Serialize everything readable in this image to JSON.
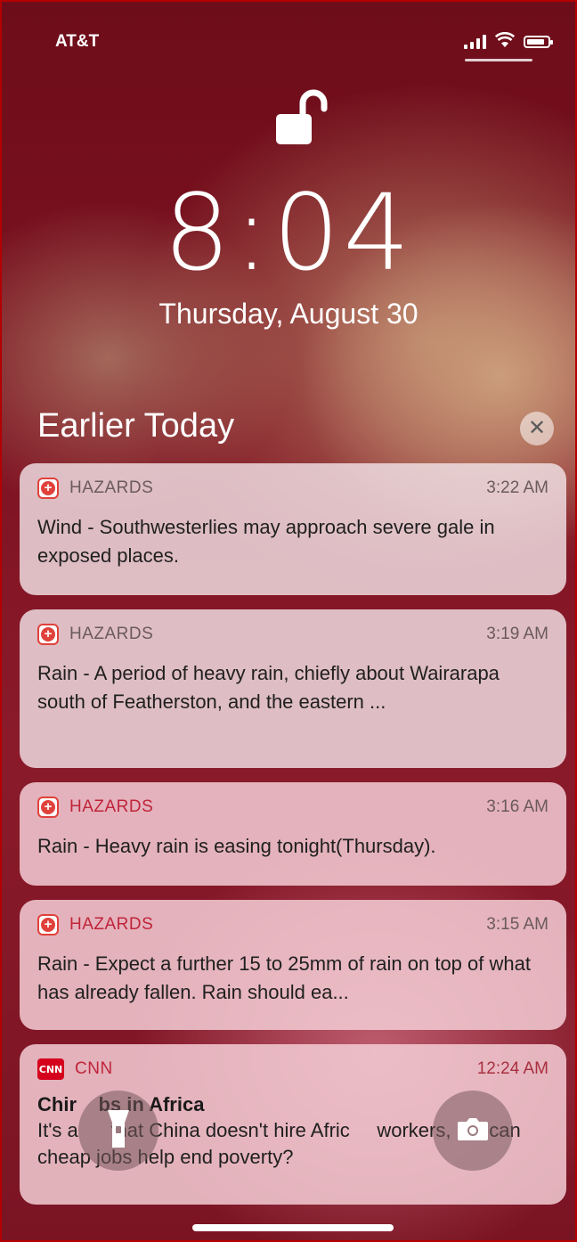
{
  "status": {
    "carrier": "AT&T",
    "signal_bars": 4
  },
  "clock": {
    "time": "8:04",
    "date": "Thursday, August 30"
  },
  "section": {
    "title": "Earlier Today",
    "clear_icon": "close-icon"
  },
  "notifications": [
    {
      "app": "HAZARDS",
      "time": "3:22 AM",
      "body": "Wind - Southwesterlies may approach severe gale in exposed places."
    },
    {
      "app": "HAZARDS",
      "time": "3:19 AM",
      "body": "Rain - A period of heavy rain, chiefly about Wairarapa south of Featherston, and the eastern ..."
    },
    {
      "app": "HAZARDS",
      "time": "3:16 AM",
      "body": "Rain - Heavy rain is easing tonight(Thursday)."
    },
    {
      "app": "HAZARDS",
      "time": "3:15 AM",
      "body": "Rain - Expect a further 15 to 25mm of rain on top of what has already fallen.  Rain should ea..."
    },
    {
      "app": "CNN",
      "time": "12:24 AM",
      "title": "Chir    bs in Africa",
      "body": "It's a      that China doesn't hire Afric     workers, but can cheap jobs help end poverty?"
    }
  ],
  "controls": {
    "flashlight_icon": "flashlight-icon",
    "camera_icon": "camera-icon"
  },
  "colors": {
    "hazard_red": "#e0413b",
    "cnn_red": "#d4001c",
    "background": "#7c1120"
  }
}
